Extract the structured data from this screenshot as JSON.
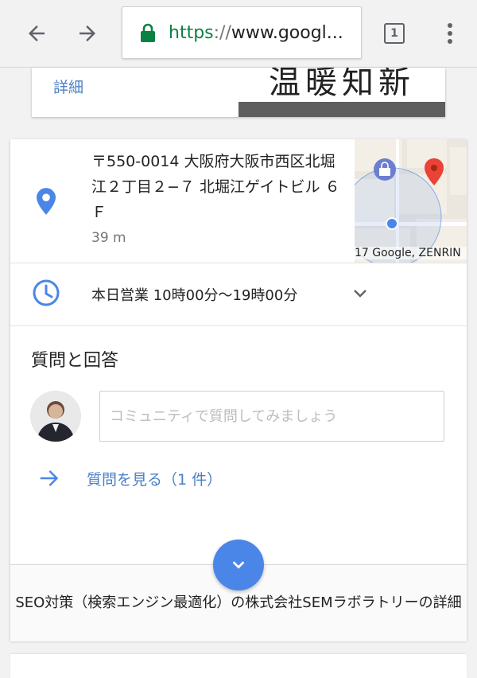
{
  "browser": {
    "url_scheme": "https",
    "url_separator": "://",
    "url_host": "www.googl...",
    "tab_count": "1"
  },
  "top_card": {
    "detail_link": "詳細",
    "image_text": "温暖知新"
  },
  "place": {
    "address": "〒550-0014 大阪府大阪市西区北堀江２丁目２−７ 北堀江ゲイトビル ６Ｆ",
    "distance": "39 m",
    "map_credit": "17 Google, ZENRIN",
    "hours": "本日営業 10時00分〜19時00分"
  },
  "qa": {
    "title": "質問と回答",
    "input_placeholder": "コミュニティで質問してみましょう",
    "see_questions": "質問を見る（1 件）"
  },
  "footer": {
    "more_details": "SEO対策（検索エンジン最適化）の株式会社SEMラボラトリーの詳細"
  },
  "colors": {
    "accent_blue": "#4a80c8",
    "fab_blue": "#4a86e8",
    "secure_green": "#0b8043",
    "map_pin_red": "#ea4335"
  },
  "icons": [
    "back-arrow-icon",
    "forward-arrow-icon",
    "lock-icon",
    "tabs-icon",
    "overflow-menu-icon",
    "location-pin-icon",
    "clock-icon",
    "chevron-down-icon",
    "arrow-right-icon",
    "expand-icon",
    "shopping-bag-icon",
    "map-marker-icon"
  ]
}
